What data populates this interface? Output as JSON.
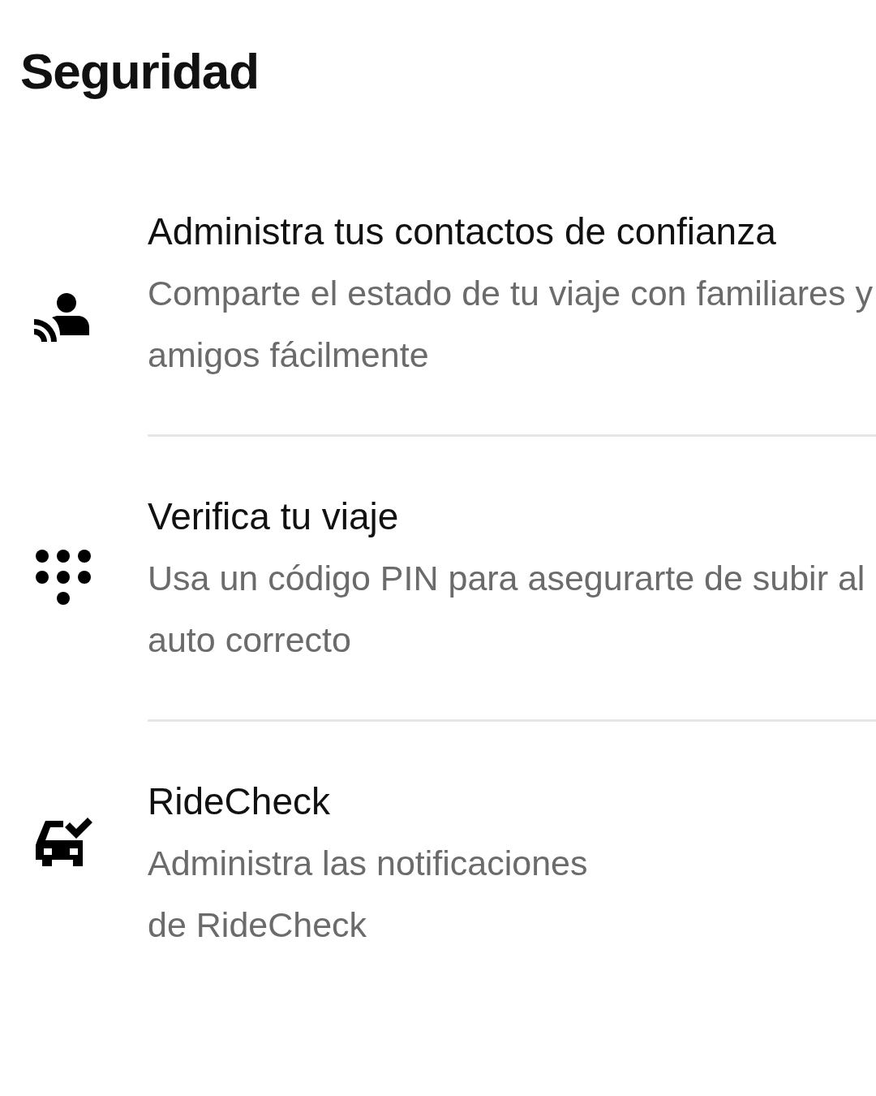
{
  "title": "Seguridad",
  "items": [
    {
      "kind": "contacts",
      "title": "Administra tus contactos de confianza",
      "subtitle": "Comparte el estado de tu viaje con familiares y amigos fácilmente"
    },
    {
      "kind": "pin",
      "title": "Verifica tu viaje",
      "subtitle": "Usa un código PIN para asegurarte de subir al auto correcto"
    },
    {
      "kind": "ridecheck",
      "title": "RideCheck",
      "subtitle": "Administra las notificaciones\nde RideCheck"
    }
  ]
}
